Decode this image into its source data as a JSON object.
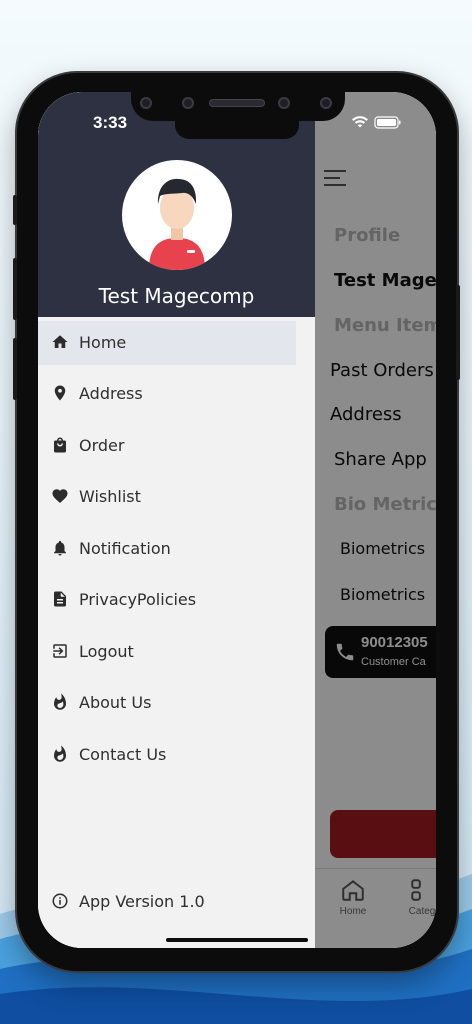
{
  "status_bar": {
    "time": "3:33"
  },
  "drawer": {
    "user_name": "Test Magecomp",
    "items": [
      {
        "label": "Home",
        "icon": "home-icon",
        "active": true
      },
      {
        "label": "Address",
        "icon": "location-pin-icon"
      },
      {
        "label": "Order",
        "icon": "shopping-bag-icon"
      },
      {
        "label": "Wishlist",
        "icon": "heart-icon"
      },
      {
        "label": "Notification",
        "icon": "bell-icon"
      },
      {
        "label": "PrivacyPolicies",
        "icon": "document-icon"
      },
      {
        "label": "Logout",
        "icon": "logout-icon"
      },
      {
        "label": "About Us",
        "icon": "flame-icon"
      },
      {
        "label": "Contact Us",
        "icon": "flame-icon"
      }
    ],
    "footer": {
      "label": "App Version 1.0",
      "icon": "info-icon"
    }
  },
  "background_page": {
    "items": [
      "Profile",
      "Test Magec",
      "Menu Item",
      "Past Orders",
      "Address",
      "Share App",
      "Bio Metrics",
      "Biometrics",
      "Biometrics"
    ],
    "call": {
      "number": "90012305",
      "caption": "Customer Ca"
    },
    "tabs": [
      "Home",
      "Categ"
    ]
  },
  "colors": {
    "drawer_header": "#2d3142",
    "drawer_bg": "#f2f2f2",
    "active_item": "#e3e7ed",
    "accent_red": "#a21c22"
  }
}
